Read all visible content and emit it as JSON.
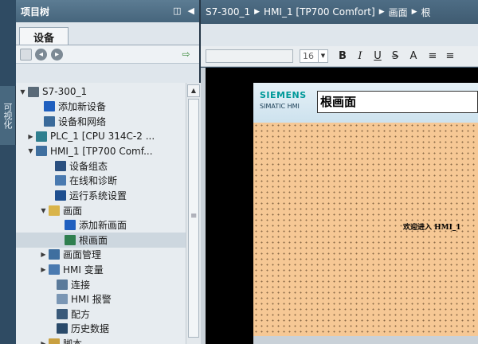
{
  "side_strip": {
    "label": "可视化"
  },
  "project_tree": {
    "title": "项目树",
    "header_buttons": [
      "◫",
      "◀"
    ],
    "tab_label": "设备",
    "items": [
      {
        "label": "S7-300_1",
        "arrow": "▼",
        "icon": "document-icon",
        "color": "#5a6a78"
      },
      {
        "label": "添加新设备",
        "arrow": "",
        "icon": "add-device-icon",
        "color": "#1f5fbf"
      },
      {
        "label": "设备和网络",
        "arrow": "",
        "icon": "network-icon",
        "color": "#3a6a9a"
      },
      {
        "label": "PLC_1 [CPU 314C-2 ...",
        "arrow": "▶",
        "icon": "plc-icon",
        "color": "#2f7f8f"
      },
      {
        "label": "HMI_1 [TP700 Comf...",
        "arrow": "▼",
        "icon": "hmi-icon",
        "color": "#3f6f9f"
      },
      {
        "label": "设备组态",
        "arrow": "",
        "icon": "device-config-icon",
        "color": "#2a4f7f"
      },
      {
        "label": "在线和诊断",
        "arrow": "",
        "icon": "diagnostics-icon",
        "color": "#4a7ab0"
      },
      {
        "label": "运行系统设置",
        "arrow": "",
        "icon": "runtime-settings-icon",
        "color": "#1f4f8f"
      },
      {
        "label": "画面",
        "arrow": "▼",
        "icon": "folder-icon",
        "color": "#d9b44a"
      },
      {
        "label": "添加新画面",
        "arrow": "",
        "icon": "add-screen-icon",
        "color": "#1f5fbf"
      },
      {
        "label": "根画面",
        "arrow": "",
        "icon": "screen-icon",
        "color": "#2f7f4f"
      },
      {
        "label": "画面管理",
        "arrow": "▶",
        "icon": "screen-management-icon",
        "color": "#3f6f9f"
      },
      {
        "label": "HMI 变量",
        "arrow": "▶",
        "icon": "hmi-tags-icon",
        "color": "#4a7ab0"
      },
      {
        "label": "连接",
        "arrow": "",
        "icon": "connection-icon",
        "color": "#5a7a9a"
      },
      {
        "label": "HMI 报警",
        "arrow": "",
        "icon": "alarm-icon",
        "color": "#7a96b4"
      },
      {
        "label": "配方",
        "arrow": "",
        "icon": "recipe-icon",
        "color": "#3a5a7a"
      },
      {
        "label": "历史数据",
        "arrow": "",
        "icon": "history-icon",
        "color": "#2a4a6a"
      },
      {
        "label": "脚本",
        "arrow": "▶",
        "icon": "script-icon",
        "color": "#c9a040"
      }
    ],
    "selected_index": 10
  },
  "breadcrumb": {
    "parts": [
      "S7-300_1",
      "HMI_1 [TP700 Comfort]",
      "画面",
      "根"
    ],
    "separator": "▶"
  },
  "format_toolbar": {
    "font_size": "16",
    "buttons": [
      "B",
      "I",
      "U",
      "S",
      "A",
      "≡",
      "≡"
    ]
  },
  "hmi": {
    "brand": "SIEMENS",
    "product": "SIMATIC HMI",
    "screen_name": "根画面",
    "welcome_text": "欢迎进入 HMI_1"
  },
  "colors": {
    "panel_header": "#4e6d85",
    "tree_bg": "#e7ecf0",
    "selection": "#cdd7df",
    "hmi_screen": "#f6c895",
    "siemens_teal": "#009999"
  }
}
